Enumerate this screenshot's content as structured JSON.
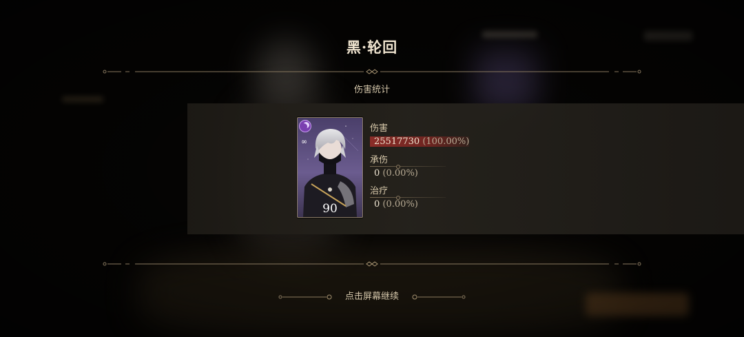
{
  "stage_title": "黑·轮回",
  "section_title": "伤害统计",
  "character": {
    "level": "90",
    "portrait_icon": "masked-silver-hair-character",
    "element_icon": "moon-icon",
    "type_icon": "link-icon"
  },
  "stats": {
    "damage": {
      "label": "伤害",
      "value": "25517730",
      "percent": "(100.00%)"
    },
    "taken": {
      "label": "承伤",
      "value": "0",
      "percent": "(0.00%)"
    },
    "heal": {
      "label": "治疗",
      "value": "0",
      "percent": "(0.00%)"
    }
  },
  "continue_prompt": "点击屏幕继续",
  "colors": {
    "accent_gold": "#8a7a60",
    "damage_highlight": "#8a2d28",
    "card_purple": "#6b5c8f"
  }
}
